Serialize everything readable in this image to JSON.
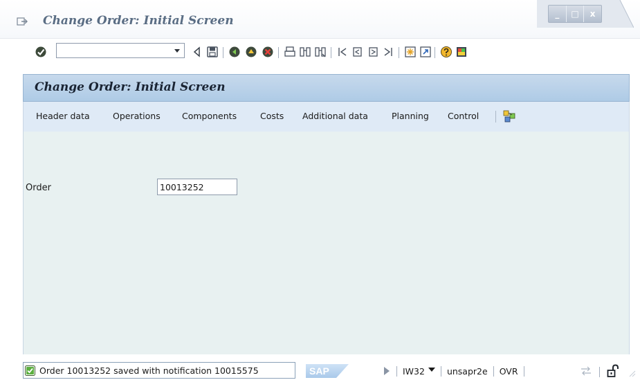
{
  "window": {
    "title": "Change Order: Initial Screen",
    "controls": [
      "_",
      "□",
      "x"
    ],
    "icons": {
      "menu": "menu-arrow-icon"
    }
  },
  "toolbar": {
    "command_field": {
      "value": "",
      "placeholder": ""
    },
    "icons": [
      "enter-icon",
      "dropdown-icon",
      "back-triangle-icon",
      "save-icon",
      "back-icon",
      "exit-icon",
      "cancel-icon",
      "print-icon",
      "find-icon",
      "find-next-icon",
      "first-page-icon",
      "previous-page-icon",
      "next-page-icon",
      "last-page-icon",
      "new-session-icon",
      "shortcut-icon",
      "help-icon",
      "customize-layout-icon"
    ]
  },
  "screen": {
    "title": "Change Order: Initial Screen",
    "app_toolbar": [
      "Header data",
      "Operations",
      "Components",
      "Costs",
      "Additional data",
      "Planning",
      "Control"
    ],
    "app_toolbar_icon": "object-links-icon"
  },
  "form": {
    "order_label": "Order",
    "order_value": "10013252"
  },
  "status": {
    "message": "Order 10013252 saved with notification 10015575",
    "transaction": "IW32",
    "server": "unsapr2e",
    "mode": "OVR",
    "logo": "SAP"
  },
  "colors": {
    "title_text": "#5a6d84",
    "header_band": "#aecbe6",
    "app_toolbar_bg": "#dfeaf6",
    "content_bg": "#e8f1f1",
    "success_green": "#3a9a2a"
  }
}
